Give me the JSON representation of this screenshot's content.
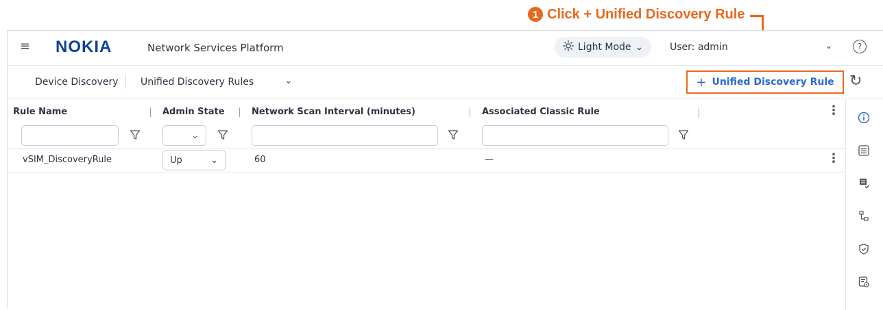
{
  "callout": {
    "number": "1",
    "text": "Click + Unified Discovery Rule"
  },
  "header": {
    "logo_text": "NOKIA",
    "app_title": "Network Services Platform",
    "mode_label": "Light Mode",
    "user_label": "User: admin"
  },
  "subheader": {
    "breadcrumb_1": "Device Discovery",
    "breadcrumb_2": "Unified Discovery Rules",
    "add_button_plus": "+",
    "add_button_label": "Unified Discovery Rule"
  },
  "table": {
    "columns": [
      "Rule Name",
      "Admin State",
      "Network Scan Interval (minutes)",
      "Associated Classic Rule"
    ],
    "rows": [
      {
        "rule_name": "vSIM_DiscoveryRule",
        "admin_state": "Up",
        "scan_interval": "60",
        "classic_rule": "—"
      }
    ]
  },
  "rail_icons": [
    "info-icon",
    "list-icon",
    "document-check-icon",
    "topology-icon",
    "shield-check-icon",
    "settings-report-icon"
  ],
  "colors": {
    "accent_orange": "#e8681f",
    "primary_blue": "#2a6ad0",
    "logo_blue": "#124191"
  }
}
